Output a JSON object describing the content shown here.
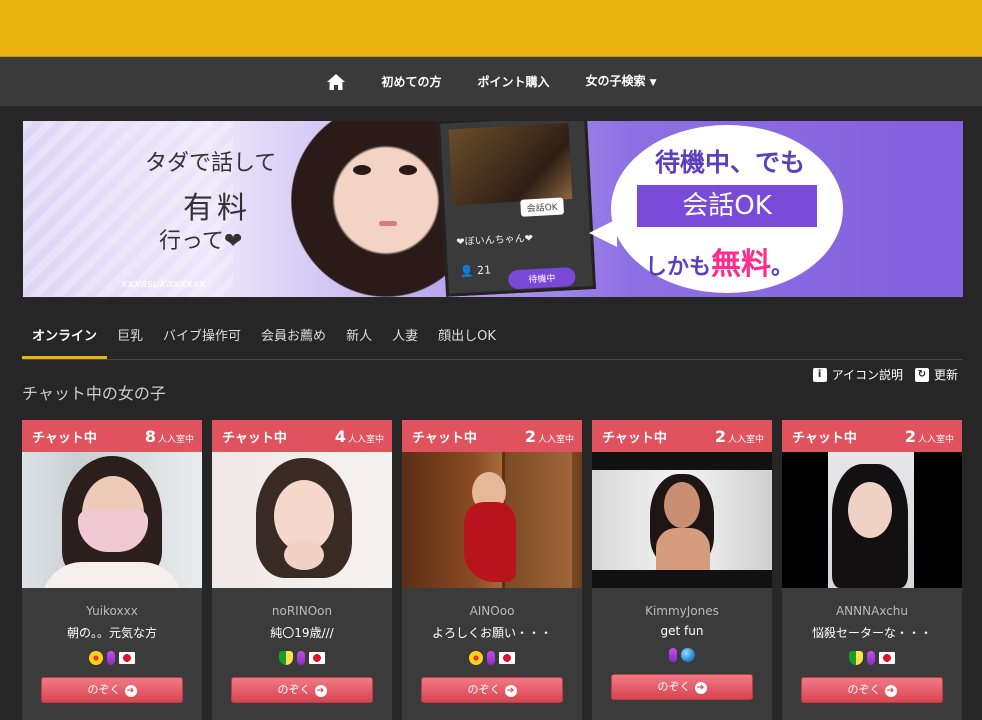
{
  "nav": {
    "home_icon": "home-icon",
    "items": [
      "初めての方",
      "ポイント購入",
      "女の子検索"
    ],
    "caret": "▼"
  },
  "banner": {
    "text1": "タダで話して",
    "text2": "有料",
    "text3": "行って❤",
    "watermark": "xxxasukaxxxxx",
    "card_ok": "会話OK",
    "card_name": "❤ぼいんちゃん❤",
    "card_count": "21",
    "card_status": "待機中",
    "line1": "待機中、でも",
    "line2": "会話OK",
    "line3_prefix": "しかも",
    "line3_free": "無料",
    "line3_suffix": "。"
  },
  "tabs": [
    {
      "label": "オンライン",
      "active": true
    },
    {
      "label": "巨乳",
      "active": false
    },
    {
      "label": "バイブ操作可",
      "active": false
    },
    {
      "label": "会員お薦め",
      "active": false
    },
    {
      "label": "新人",
      "active": false
    },
    {
      "label": "人妻",
      "active": false
    },
    {
      "label": "顔出しOK",
      "active": false
    }
  ],
  "section": {
    "title": "チャット中の女の子",
    "icon_help": "アイコン説明",
    "refresh": "更新"
  },
  "cards": [
    {
      "status": "チャット中",
      "count": "8",
      "count_suffix": "人入室中",
      "name": "Yuikoxxx",
      "message": "朝の。。元気な方",
      "icons": [
        "flower",
        "vibe",
        "jp-flag"
      ],
      "button": "のぞく"
    },
    {
      "status": "チャット中",
      "count": "4",
      "count_suffix": "人入室中",
      "name": "noRINOon",
      "message": "純〇19歳///",
      "icons": [
        "beginner",
        "vibe",
        "jp-flag"
      ],
      "button": "のぞく"
    },
    {
      "status": "チャット中",
      "count": "2",
      "count_suffix": "人入室中",
      "name": "AINOoo",
      "message": "よろしくお願い・・・",
      "icons": [
        "flower",
        "vibe",
        "jp-flag"
      ],
      "button": "のぞく"
    },
    {
      "status": "チャット中",
      "count": "2",
      "count_suffix": "人入室中",
      "name": "KimmyJones",
      "message": "get fun",
      "icons": [
        "vibe",
        "globe"
      ],
      "button": "のぞく"
    },
    {
      "status": "チャット中",
      "count": "2",
      "count_suffix": "人入室中",
      "name": "ANNNAxchu",
      "message": "悩殺セーターな・・・",
      "icons": [
        "beginner",
        "vibe",
        "jp-flag"
      ],
      "button": "のぞく"
    }
  ],
  "colors": {
    "topbar": "#e9b20e",
    "card_head": "#e0525e",
    "tab_active_underline": "#e9b20e",
    "banner_purple": "#7a4ad8",
    "free_pink": "#ff2b8a"
  }
}
